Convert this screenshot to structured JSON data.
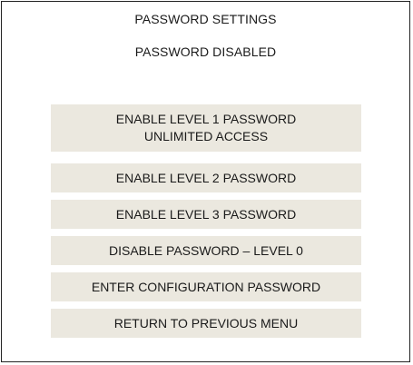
{
  "header": {
    "title": "PASSWORD SETTINGS",
    "status": "PASSWORD DISABLED"
  },
  "menu": {
    "level1": {
      "line1": "ENABLE LEVEL 1 PASSWORD",
      "line2": "UNLIMITED ACCESS"
    },
    "level2": "ENABLE LEVEL 2 PASSWORD",
    "level3": "ENABLE LEVEL 3 PASSWORD",
    "disable": "DISABLE PASSWORD – LEVEL 0",
    "config": "ENTER CONFIGURATION PASSWORD",
    "back": "RETURN TO PREVIOUS MENU"
  },
  "colors": {
    "button_background": "#ebe8df",
    "panel_border": "#222222",
    "text": "#1a1a1a"
  }
}
